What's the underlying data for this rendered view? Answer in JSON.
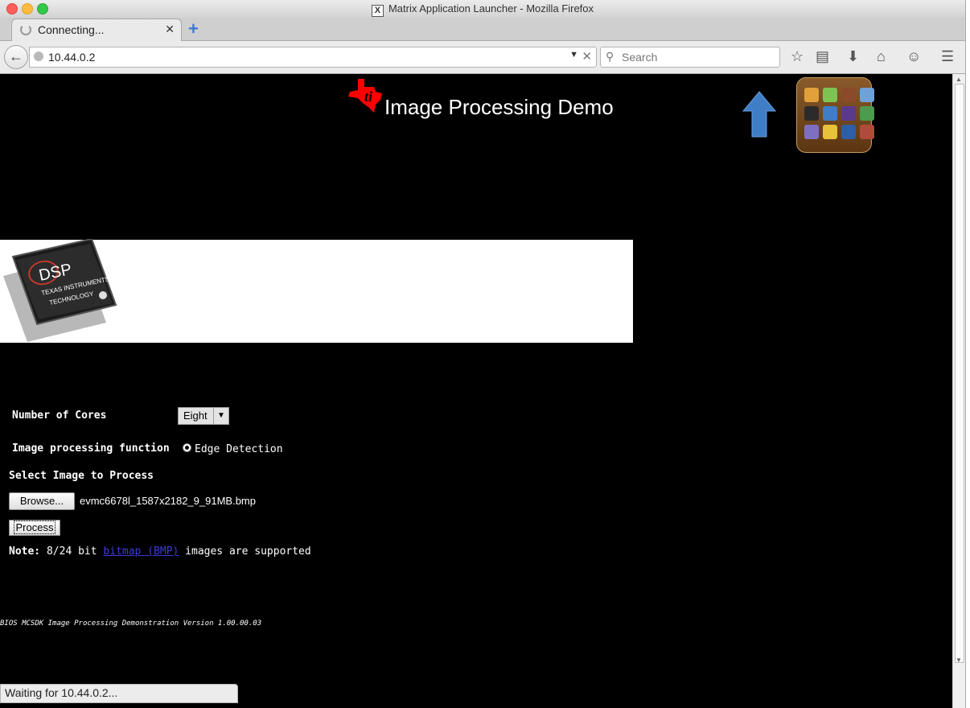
{
  "window": {
    "title": "Matrix Application Launcher - Mozilla Firefox"
  },
  "tab": {
    "title": "Connecting..."
  },
  "navbar": {
    "url": "10.44.0.2",
    "search_placeholder": "Search"
  },
  "page": {
    "title": "Image Processing Demo",
    "chip_text_1": "DSP",
    "chip_text_2": "TEXAS INSTRUMENTS",
    "chip_text_3": "TECHNOLOGY",
    "cores_label": "Number of Cores",
    "cores_value": "Eight",
    "function_label": "Image processing function",
    "function_option": "Edge Detection",
    "select_label": "Select Image to Process",
    "browse_label": "Browse...",
    "file_name": "evmc6678l_1587x2182_9_91MB.bmp",
    "process_label": "Process",
    "note_prefix": "Note:",
    "note_mid": "8/24 bit",
    "note_link": "bitmap (BMP)",
    "note_suffix": "images are supported",
    "version": "BIOS MCSDK Image Processing Demonstration Version 1.00.00.03"
  },
  "status": {
    "text": "Waiting for 10.44.0.2..."
  },
  "colors": {
    "ti_red": "#ff0000",
    "arrow_blue": "#3f7ec7",
    "launcher_brown": "#6e4419",
    "link_blue": "#3b3bdc"
  }
}
